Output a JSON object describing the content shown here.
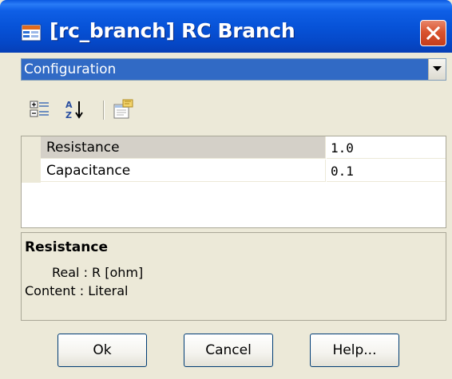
{
  "window": {
    "title": "[rc_branch] RC Branch",
    "app_icon": "property-window-icon",
    "close_icon": "close-x-icon"
  },
  "combo": {
    "selected": "Configuration",
    "arrow_icon": "dropdown-arrow-icon"
  },
  "toolbar": {
    "categorized_icon": "categorized-view-icon",
    "alphabetical_icon": "alphabetical-sort-icon",
    "property_pages_icon": "property-pages-icon"
  },
  "properties": [
    {
      "name": "Resistance",
      "value": "1.0",
      "selected": true
    },
    {
      "name": "Capacitance",
      "value": "0.1",
      "selected": false
    }
  ],
  "description": {
    "title": "Resistance",
    "type_line": "Real : R [ohm]",
    "content_line": "Content : Literal"
  },
  "buttons": {
    "ok": "Ok",
    "cancel": "Cancel",
    "help": "Help..."
  },
  "colors": {
    "titlebar": "#0753d8",
    "selection": "#316ac5",
    "close": "#d9542f",
    "face": "#ece9d8"
  }
}
